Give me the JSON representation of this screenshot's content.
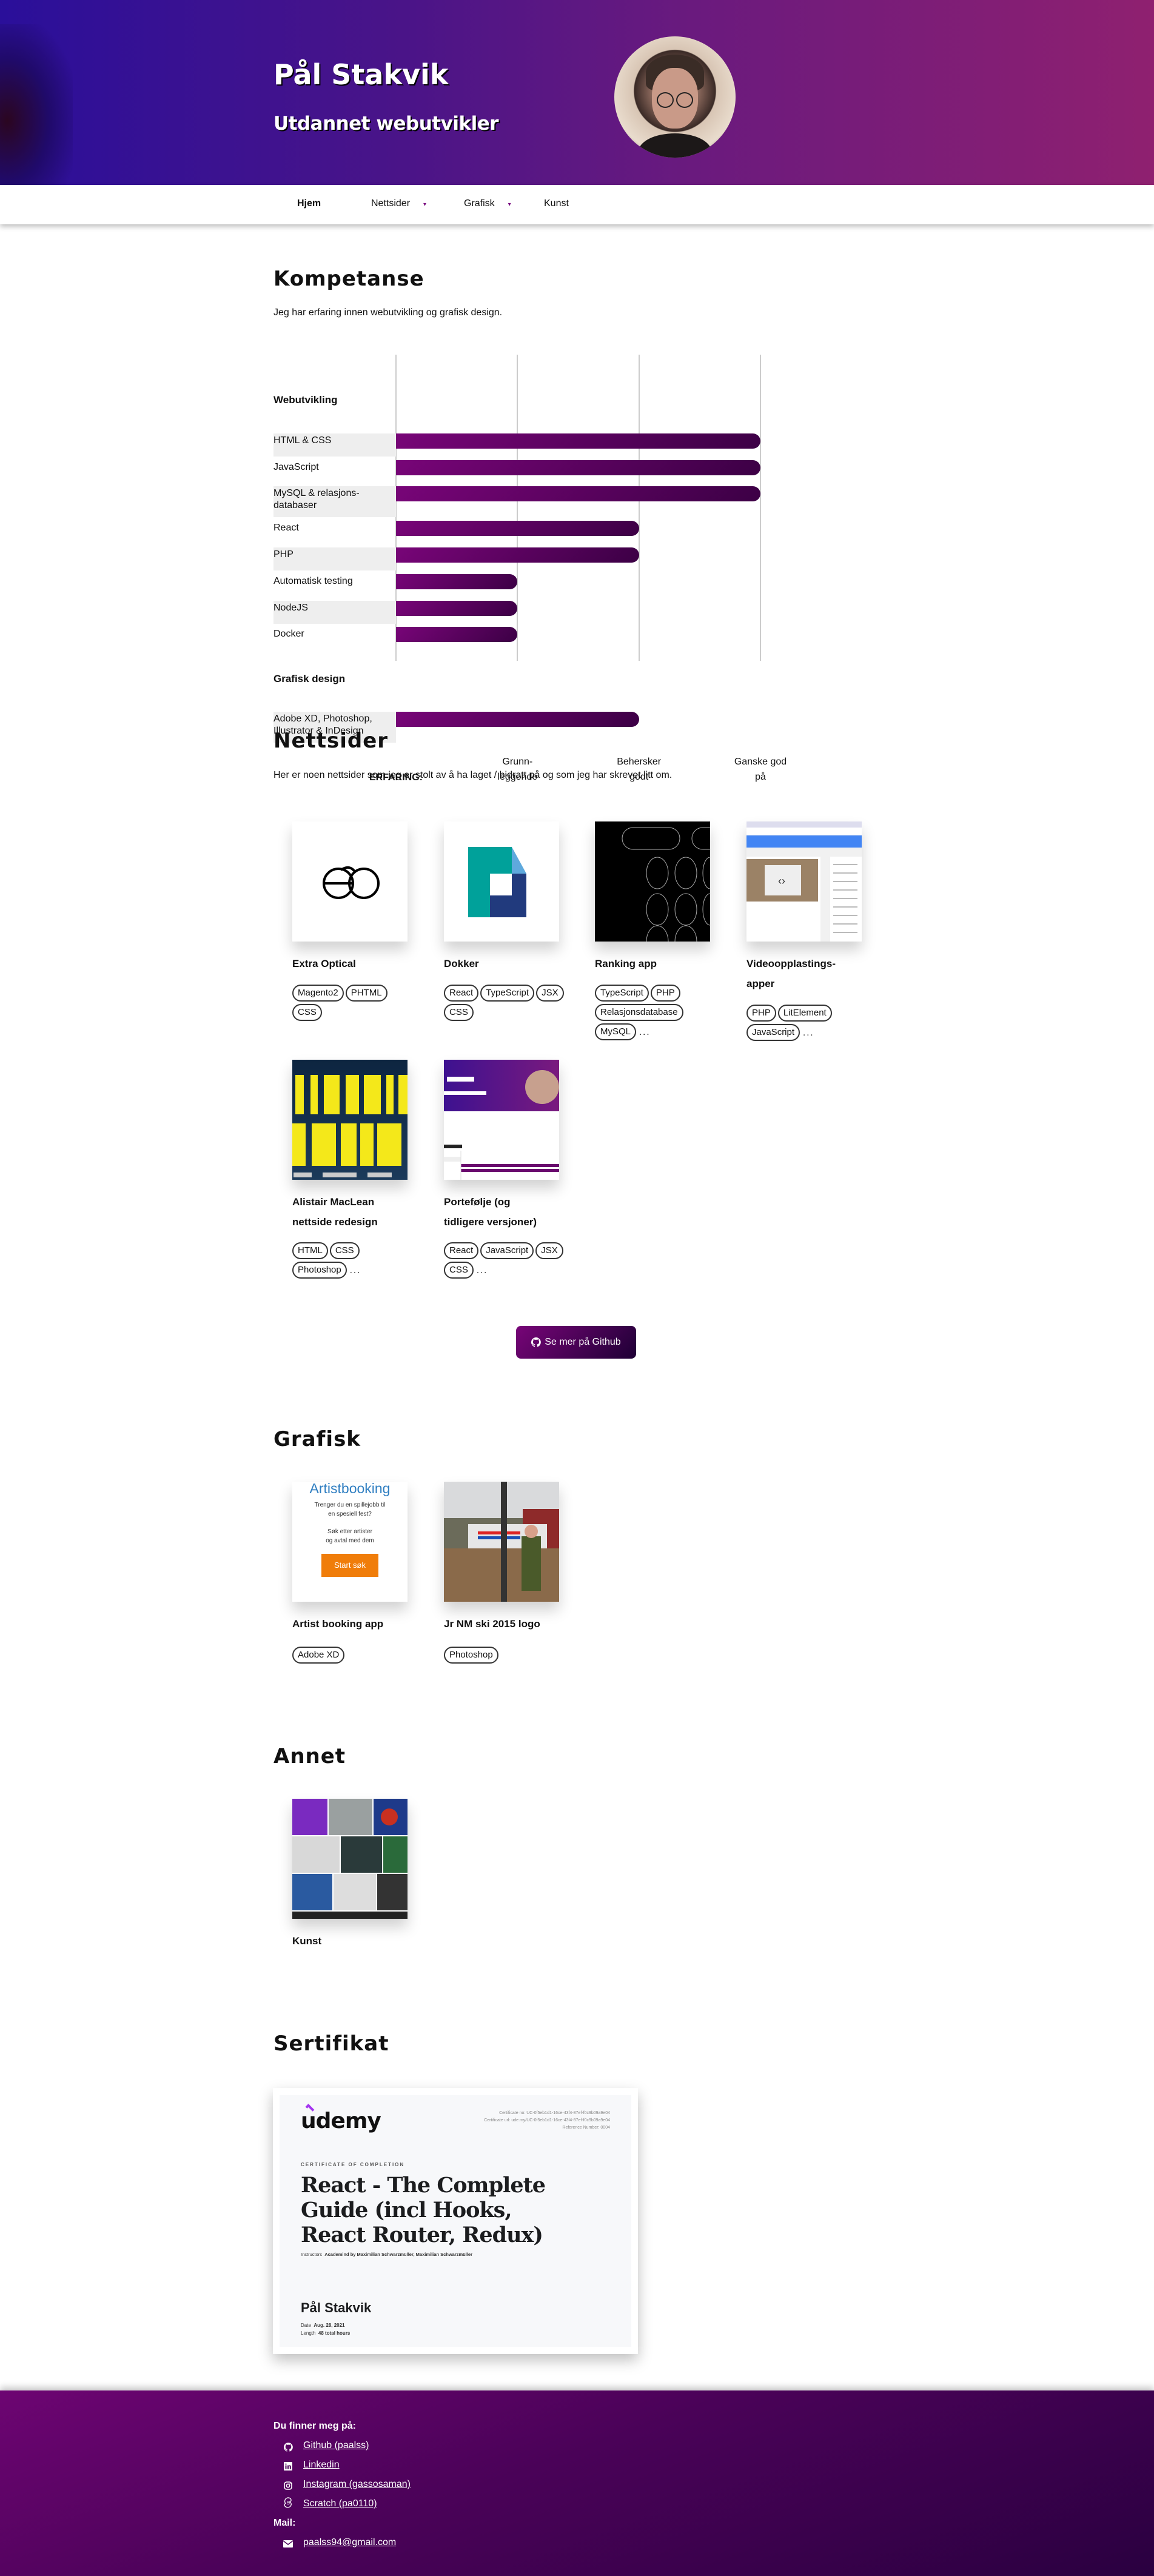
{
  "header": {
    "name": "Pål Stakvik",
    "subtitle": "Utdannet webutvikler"
  },
  "nav": {
    "items": [
      {
        "label": "Hjem",
        "active": true
      },
      {
        "label": "Nettsider",
        "dropdown": true
      },
      {
        "label": "Grafisk",
        "dropdown": true
      },
      {
        "label": "Kunst"
      }
    ],
    "caret": "▾"
  },
  "kompetanse": {
    "title": "Kompetanse",
    "intro": "Jeg har erfaring innen webutvikling og grafisk design."
  },
  "chart_data": {
    "type": "bar",
    "orientation": "horizontal",
    "groups": [
      {
        "name": "Webutvikling",
        "items": [
          {
            "label": "HTML & CSS",
            "value": 3
          },
          {
            "label": "JavaScript",
            "value": 3
          },
          {
            "label": "MySQL & relasjons-\ndatabaser",
            "value": 3
          },
          {
            "label": "React",
            "value": 2
          },
          {
            "label": "PHP",
            "value": 2
          },
          {
            "label": "Automatisk testing",
            "value": 1
          },
          {
            "label": "NodeJS",
            "value": 1
          },
          {
            "label": "Docker",
            "value": 1
          }
        ]
      },
      {
        "name": "Grafisk design",
        "items": [
          {
            "label": "Adobe XD, Photoshop,\nIllustrator & InDesign",
            "value": 2
          }
        ]
      }
    ],
    "xlabel": "ERFARING:",
    "ticks": [
      {
        "value": 1,
        "label": "Grunn-\nleggende"
      },
      {
        "value": 2,
        "label": "Behersker\ngodt"
      },
      {
        "value": 3,
        "label": "Ganske god\npå"
      }
    ],
    "xlim": [
      0,
      3
    ],
    "grid": true,
    "bar_color": "#780578"
  },
  "nettsider": {
    "title": "Nettsider",
    "intro": "Her er noen nettsider som jeg er stolt av å ha laget / bidratt på og som jeg har skrevet litt om.",
    "cards": [
      {
        "title": "Extra Optical",
        "thumb": "eo",
        "tags": [
          "Magento2",
          "PHTML",
          "CSS"
        ]
      },
      {
        "title": "Dokker",
        "thumb": "dokker",
        "tags": [
          "React",
          "TypeScript",
          "JSX",
          "CSS"
        ]
      },
      {
        "title": "Ranking app",
        "thumb": "ranking",
        "tags": [
          "TypeScript",
          "PHP",
          "Relasjonsdatabase",
          "MySQL"
        ],
        "more": "..."
      },
      {
        "title": "Videoopplastings-\napper",
        "thumb": "video",
        "tags": [
          "PHP",
          "LitElement",
          "JavaScript"
        ],
        "more": "..."
      },
      {
        "title": "Alistair MacLean\nnettside redesign",
        "thumb": "maclean",
        "tags": [
          "HTML",
          "CSS",
          "Photoshop"
        ],
        "more": "..."
      },
      {
        "title": "Portefølje (og\ntidligere versjoner)",
        "thumb": "portfolio",
        "tags": [
          "React",
          "JavaScript",
          "JSX",
          "CSS"
        ],
        "more": "..."
      }
    ],
    "github_button": "Se mer på Github"
  },
  "grafisk": {
    "title": "Grafisk",
    "cards": [
      {
        "title": "Artist booking app",
        "thumb": "artist",
        "tags": [
          "Adobe XD"
        ]
      },
      {
        "title": "Jr NM ski 2015 logo",
        "thumb": "jrnm",
        "tags": [
          "Photoshop"
        ]
      }
    ],
    "artist_mock": {
      "heading": "Artistbooking",
      "line1": "Trenger du en spillejobb til\nen spesiell fest?",
      "line2": "Søk etter artister\nog avtal med dem",
      "button": "Start søk"
    }
  },
  "annet": {
    "title": "Annet",
    "cards": [
      {
        "title": "Kunst",
        "thumb": "kunst",
        "tags": []
      }
    ]
  },
  "sertifikat": {
    "title": "Sertifikat",
    "cert": {
      "brand": "udemy",
      "cert_no": "Certificate no: UC-0f5eb1d1-16ce-43f4-87ef-f0c9b09a9e04",
      "cert_url": "Certificate url: ude.my/UC-0f5eb1d1-16ce-43f4-87ef-f0c9b09a9e04",
      "ref": "Reference Number: 0004",
      "kicker": "CERTIFICATE OF COMPLETION",
      "course": "React - The Complete Guide (incl Hooks, React Router, Redux)",
      "instructors_label": "Instructors",
      "instructors": "Academind by Maximilian Schwarzmüller,  Maximilian Schwarzmüller",
      "student": "Pål Stakvik",
      "date_label": "Date",
      "date": "Aug. 28, 2021",
      "length_label": "Length",
      "length": "48 total hours"
    }
  },
  "footer": {
    "find_me": "Du finner meg på:",
    "links": [
      {
        "label": "Github (paalss)",
        "icon": "github"
      },
      {
        "label": "Linkedin",
        "icon": "linkedin"
      },
      {
        "label": "Instagram (gassosaman)",
        "icon": "instagram"
      },
      {
        "label": "Scratch (pa0110)",
        "icon": "scratch"
      }
    ],
    "mail_heading": "Mail:",
    "email": "paalss94@gmail.com"
  }
}
